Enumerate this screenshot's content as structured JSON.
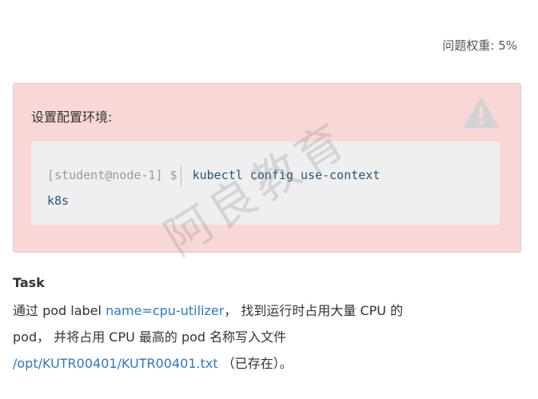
{
  "header": {
    "weight_text": "问题权重: 5%"
  },
  "notice": {
    "title": "设置配置环境:",
    "icon": "warning-icon",
    "code": {
      "prompt": "[student@node-1] $",
      "command": "kubectl config use-context",
      "command_cont": "k8s"
    }
  },
  "watermark": "阿良教育",
  "task": {
    "heading": "Task",
    "line1_pre": "通过 pod label ",
    "label_selector": "name=cpu-utilizer",
    "line1_post": "， 找到运行时占用大量 CPU 的",
    "line2": "pod， 并将占用 CPU 最高的 pod 名称写入文件",
    "file_path": "/opt/KUTR00401/KUTR00401.txt",
    "line3_post": " （已存在）。"
  },
  "colors": {
    "notice_bg": "#f8d7d7",
    "code_bg": "#efefef",
    "link": "#2b7bbf",
    "command": "#24587a"
  }
}
